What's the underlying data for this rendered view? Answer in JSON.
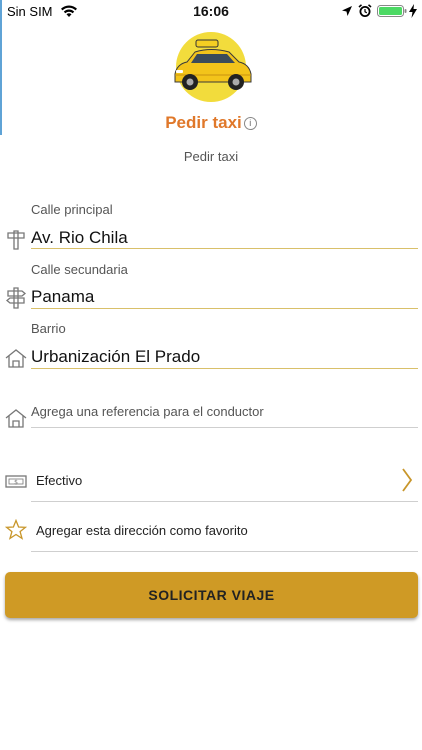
{
  "status_bar": {
    "carrier": "Sin SIM",
    "time": "16:06"
  },
  "header": {
    "title": "Pedir taxi",
    "info_glyph": "i",
    "subtitle": "Pedir taxi"
  },
  "form": {
    "calle_principal": {
      "label": "Calle principal",
      "value": "Av. Rio Chila"
    },
    "calle_secundaria": {
      "label": "Calle secundaria",
      "value": "Panama"
    },
    "barrio": {
      "label": "Barrio",
      "value": "Urbanización El Prado"
    },
    "referencia": {
      "placeholder": "Agrega una referencia para el conductor"
    }
  },
  "payment": {
    "label": "Efectivo"
  },
  "favorite": {
    "label": "Agregar esta dirección como favorito"
  },
  "cta": {
    "label": "SOLICITAR VIAJE"
  },
  "colors": {
    "accent_orange": "#e0782a",
    "button_gold": "#cf9a25",
    "underline_gold": "#d9c06a",
    "battery_green": "#4cd964"
  }
}
